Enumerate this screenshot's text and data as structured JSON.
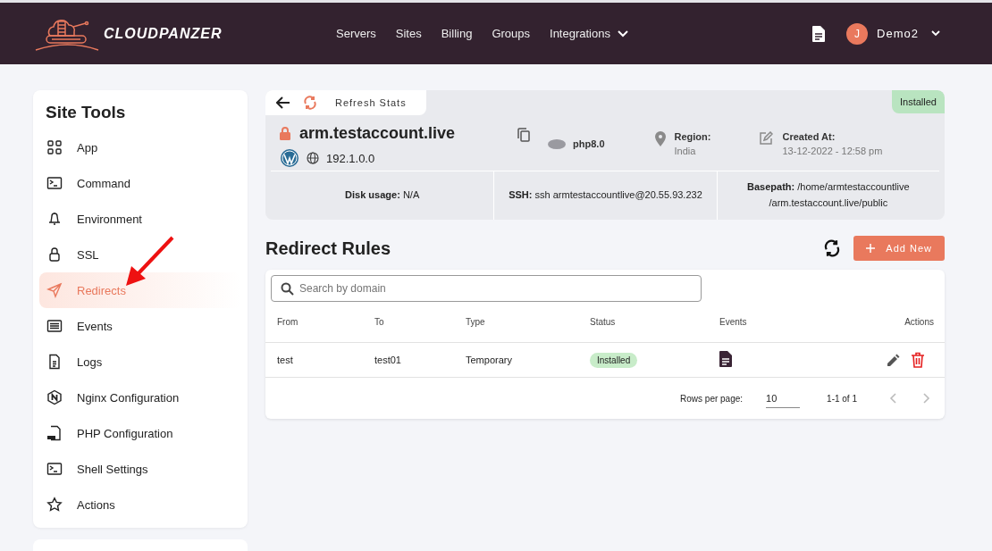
{
  "header": {
    "logo": "CLOUDPANZER",
    "nav": [
      {
        "label": "Servers",
        "dropdown": false
      },
      {
        "label": "Sites",
        "dropdown": false
      },
      {
        "label": "Billing",
        "dropdown": false
      },
      {
        "label": "Groups",
        "dropdown": false
      },
      {
        "label": "Integrations",
        "dropdown": true
      }
    ],
    "user": {
      "initial": "J",
      "name": "Demo2"
    }
  },
  "sidebar": {
    "title": "Site Tools",
    "items": [
      {
        "label": "App",
        "kind": "grid",
        "selected": false
      },
      {
        "label": "Command",
        "kind": "terminal",
        "selected": false
      },
      {
        "label": "Environment",
        "kind": "bell",
        "selected": false
      },
      {
        "label": "SSL",
        "kind": "lock",
        "selected": false
      },
      {
        "label": "Redirects",
        "kind": "send",
        "selected": true
      },
      {
        "label": "Events",
        "kind": "list",
        "selected": false
      },
      {
        "label": "Logs",
        "kind": "file",
        "selected": false
      },
      {
        "label": "Nginx Configuration",
        "kind": "nginx",
        "selected": false
      },
      {
        "label": "PHP Configuration",
        "kind": "php",
        "selected": false
      },
      {
        "label": "Shell Settings",
        "kind": "terminal",
        "selected": false
      },
      {
        "label": "Actions",
        "kind": "star",
        "selected": false
      }
    ]
  },
  "site": {
    "refresh": "Refresh Stats",
    "status": "Installed",
    "domain": "arm.testaccount.live",
    "ip": "192.1.0.0",
    "php": "php8.0",
    "region_label": "Region:",
    "region": "India",
    "created_label": "Created At:",
    "created": "13-12-2022 - 12:58 pm",
    "stats": [
      {
        "text": "**Disk usage:** N/A"
      },
      {
        "text": "**SSH:** ssh armtestaccountlive@20.55.93.232"
      },
      {
        "text": "**Basepath:** /home/armtestaccountlive /arm.testaccount.live/public"
      }
    ]
  },
  "rules": {
    "title": "Redirect Rules",
    "add_label": "Add New",
    "search": {
      "placeholder": "Search by domain"
    },
    "columns": [
      "From",
      "To",
      "Type",
      "Status",
      "Events",
      "Actions"
    ],
    "rows": [
      {
        "from": "test",
        "to": "test01",
        "type": "Temporary",
        "status": "Installed"
      }
    ],
    "pagination": {
      "rows_label": "Rows per page:",
      "rows_value": "10",
      "range": "1-1 of 1"
    }
  }
}
